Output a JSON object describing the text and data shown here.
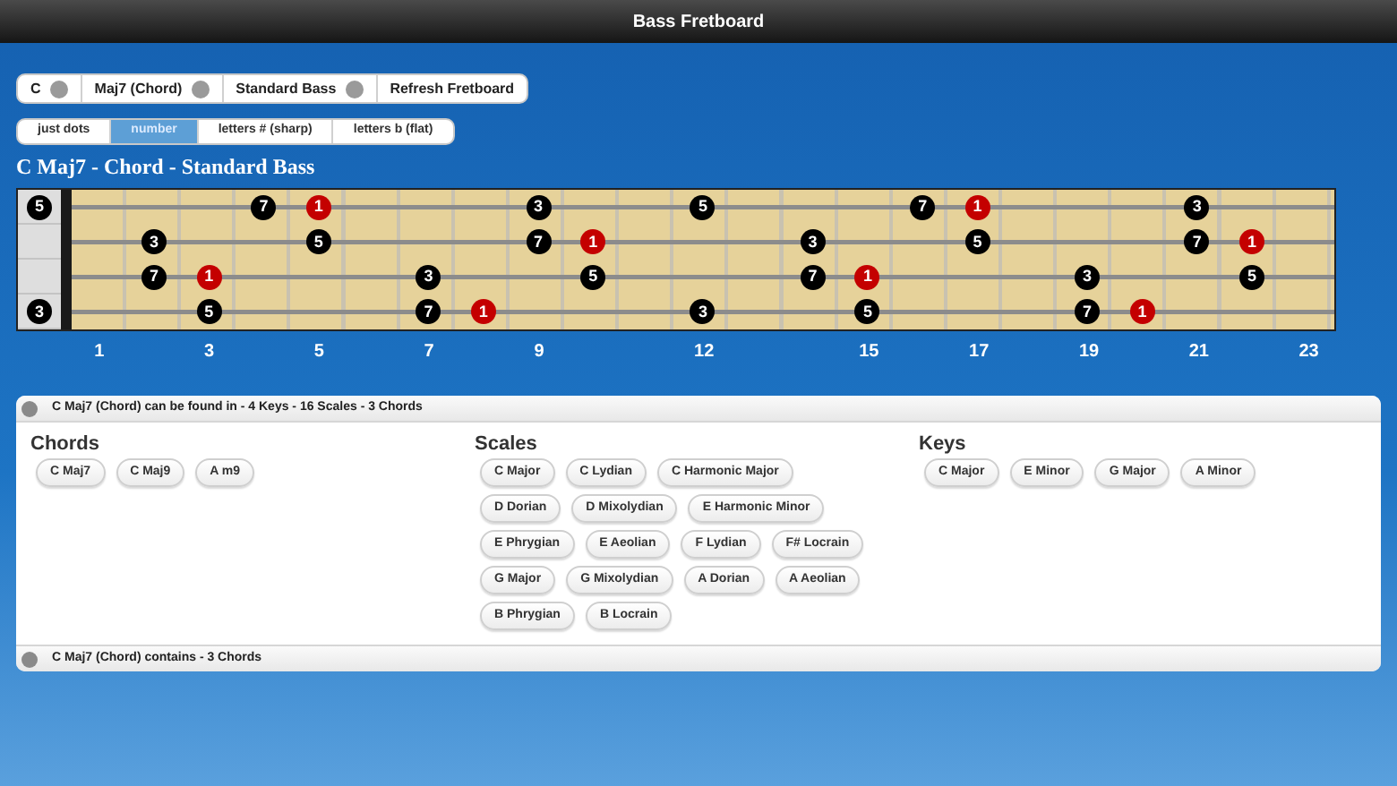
{
  "window": {
    "title": "Bass Fretboard"
  },
  "selectors": [
    {
      "label": "C",
      "kind": "picker"
    },
    {
      "label": "Maj7 (Chord)",
      "kind": "picker"
    },
    {
      "label": "Standard Bass",
      "kind": "picker"
    },
    {
      "label": "Refresh Fretboard",
      "kind": "button"
    }
  ],
  "display_tabs": [
    {
      "label": "just dots",
      "selected": false
    },
    {
      "label": "number",
      "selected": true
    },
    {
      "label": "letters # (sharp)",
      "selected": false
    },
    {
      "label": "letters b (flat)",
      "selected": false
    }
  ],
  "heading": "C Maj7 - Chord - Standard Bass",
  "fretboard": {
    "strings": [
      {
        "open": {
          "label": "5",
          "root": false
        },
        "frets": [
          {
            "kind": "empty"
          },
          {
            "kind": "empty"
          },
          {
            "kind": "empty"
          },
          {
            "kind": "note",
            "label": "7",
            "root": false
          },
          {
            "kind": "note",
            "label": "1",
            "root": true
          },
          {
            "kind": "empty"
          },
          {
            "kind": "empty"
          },
          {
            "kind": "empty"
          },
          {
            "kind": "note",
            "label": "3",
            "root": false
          },
          {
            "kind": "empty"
          },
          {
            "kind": "empty"
          },
          {
            "kind": "note",
            "label": "5",
            "root": false
          },
          {
            "kind": "empty"
          },
          {
            "kind": "empty"
          },
          {
            "kind": "empty"
          },
          {
            "kind": "note",
            "label": "7",
            "root": false
          },
          {
            "kind": "note",
            "label": "1",
            "root": true
          },
          {
            "kind": "empty"
          },
          {
            "kind": "empty"
          },
          {
            "kind": "empty"
          },
          {
            "kind": "note",
            "label": "3",
            "root": false
          },
          {
            "kind": "empty"
          },
          {
            "kind": "empty"
          }
        ]
      },
      {
        "frets": [
          {
            "kind": "empty"
          },
          {
            "kind": "note",
            "label": "3",
            "root": false
          },
          {
            "kind": "empty"
          },
          {
            "kind": "empty"
          },
          {
            "kind": "note",
            "label": "5",
            "root": false
          },
          {
            "kind": "empty"
          },
          {
            "kind": "empty"
          },
          {
            "kind": "empty"
          },
          {
            "kind": "note",
            "label": "7",
            "root": false
          },
          {
            "kind": "note",
            "label": "1",
            "root": true
          },
          {
            "kind": "empty"
          },
          {
            "kind": "empty"
          },
          {
            "kind": "empty"
          },
          {
            "kind": "note",
            "label": "3",
            "root": false
          },
          {
            "kind": "empty"
          },
          {
            "kind": "empty"
          },
          {
            "kind": "note",
            "label": "5",
            "root": false
          },
          {
            "kind": "empty"
          },
          {
            "kind": "empty"
          },
          {
            "kind": "empty"
          },
          {
            "kind": "note",
            "label": "7",
            "root": false
          },
          {
            "kind": "note",
            "label": "1",
            "root": true
          },
          {
            "kind": "empty"
          }
        ]
      },
      {
        "frets": [
          {
            "kind": "empty"
          },
          {
            "kind": "note",
            "label": "7",
            "root": false
          },
          {
            "kind": "note",
            "label": "1",
            "root": true
          },
          {
            "kind": "empty"
          },
          {
            "kind": "empty"
          },
          {
            "kind": "empty"
          },
          {
            "kind": "note",
            "label": "3",
            "root": false
          },
          {
            "kind": "empty"
          },
          {
            "kind": "empty"
          },
          {
            "kind": "note",
            "label": "5",
            "root": false
          },
          {
            "kind": "empty"
          },
          {
            "kind": "empty"
          },
          {
            "kind": "empty"
          },
          {
            "kind": "note",
            "label": "7",
            "root": false
          },
          {
            "kind": "note",
            "label": "1",
            "root": true
          },
          {
            "kind": "empty"
          },
          {
            "kind": "empty"
          },
          {
            "kind": "empty"
          },
          {
            "kind": "note",
            "label": "3",
            "root": false
          },
          {
            "kind": "empty"
          },
          {
            "kind": "empty"
          },
          {
            "kind": "note",
            "label": "5",
            "root": false
          },
          {
            "kind": "empty"
          }
        ]
      },
      {
        "open": {
          "label": "3",
          "root": false
        },
        "frets": [
          {
            "kind": "empty"
          },
          {
            "kind": "empty"
          },
          {
            "kind": "note",
            "label": "5",
            "root": false
          },
          {
            "kind": "empty"
          },
          {
            "kind": "empty"
          },
          {
            "kind": "empty"
          },
          {
            "kind": "note",
            "label": "7",
            "root": false
          },
          {
            "kind": "note",
            "label": "1",
            "root": true
          },
          {
            "kind": "empty"
          },
          {
            "kind": "empty"
          },
          {
            "kind": "empty"
          },
          {
            "kind": "note",
            "label": "3",
            "root": false
          },
          {
            "kind": "empty"
          },
          {
            "kind": "empty"
          },
          {
            "kind": "note",
            "label": "5",
            "root": false
          },
          {
            "kind": "empty"
          },
          {
            "kind": "empty"
          },
          {
            "kind": "empty"
          },
          {
            "kind": "note",
            "label": "7",
            "root": false
          },
          {
            "kind": "note",
            "label": "1",
            "root": true
          },
          {
            "kind": "empty"
          },
          {
            "kind": "empty"
          },
          {
            "kind": "empty"
          }
        ]
      }
    ],
    "fret_numbers": [
      {
        "kind": "number",
        "label": "1"
      },
      {
        "kind": "blank"
      },
      {
        "kind": "number",
        "label": "3"
      },
      {
        "kind": "blank"
      },
      {
        "kind": "number",
        "label": "5"
      },
      {
        "kind": "blank"
      },
      {
        "kind": "number",
        "label": "7"
      },
      {
        "kind": "blank"
      },
      {
        "kind": "number",
        "label": "9"
      },
      {
        "kind": "blank"
      },
      {
        "kind": "blank"
      },
      {
        "kind": "number",
        "label": "12"
      },
      {
        "kind": "blank"
      },
      {
        "kind": "blank"
      },
      {
        "kind": "number",
        "label": "15"
      },
      {
        "kind": "blank"
      },
      {
        "kind": "number",
        "label": "17"
      },
      {
        "kind": "blank"
      },
      {
        "kind": "number",
        "label": "19"
      },
      {
        "kind": "blank"
      },
      {
        "kind": "number",
        "label": "21"
      },
      {
        "kind": "blank"
      },
      {
        "kind": "number",
        "label": "23"
      }
    ]
  },
  "found_in": {
    "title": "C Maj7 (Chord) can be found in - 4 Keys - 16 Scales - 3 Chords",
    "sections": [
      {
        "title": "Chords",
        "items": [
          "C Maj7",
          "C Maj9",
          "A m9"
        ]
      },
      {
        "title": "Scales",
        "items": [
          "C Major",
          "C Lydian",
          "C Harmonic Major",
          "D Dorian",
          "D Mixolydian",
          "E Harmonic Minor",
          "E Phrygian",
          "E Aeolian",
          "F Lydian",
          "F# Locrain",
          "G Major",
          "G Mixolydian",
          "A Dorian",
          "A Aeolian",
          "B Phrygian",
          "B Locrain"
        ]
      },
      {
        "title": "Keys",
        "items": [
          "C Major",
          "E Minor",
          "G Major",
          "A Minor"
        ]
      }
    ]
  },
  "contains": {
    "title": "C Maj7 (Chord) contains - 3 Chords"
  }
}
